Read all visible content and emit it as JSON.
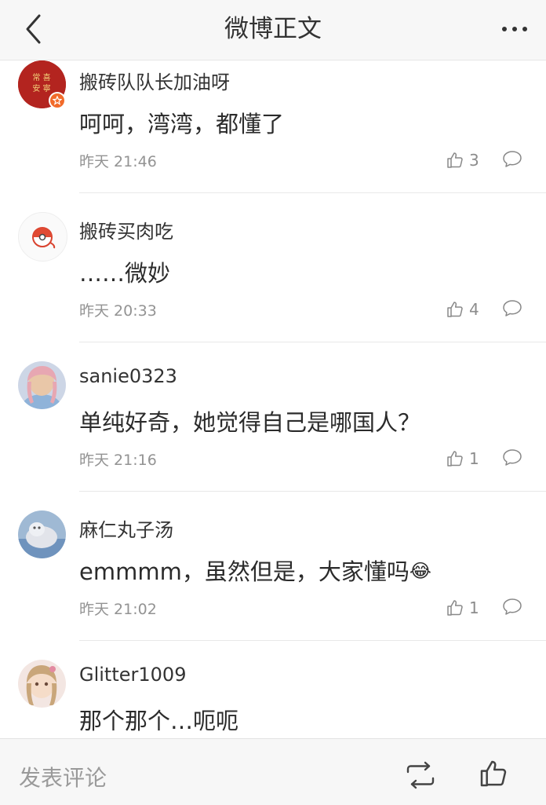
{
  "header": {
    "title": "微博正文",
    "back_icon": "chevron-left-icon",
    "more_icon": "ellipsis-icon"
  },
  "comments": [
    {
      "username": "搬砖队队长加油呀",
      "content": "呵呵，湾湾，都懂了",
      "time": "昨天 21:46",
      "likes": "3",
      "avatar_text": "常安寧"
    },
    {
      "username": "搬砖买肉吃",
      "content": "……微妙",
      "time": "昨天 20:33",
      "likes": "4"
    },
    {
      "username": "sanie0323",
      "content": "单纯好奇，她觉得自己是哪国人？",
      "time": "昨天 21:16",
      "likes": "1"
    },
    {
      "username": "麻仁丸子汤",
      "content": "emmmm，虽然但是，大家懂吗",
      "time": "昨天 21:02",
      "likes": "1",
      "emoji": "😂"
    },
    {
      "username": "Glitter1009",
      "content": "那个那个…呃呃"
    }
  ],
  "bottom_bar": {
    "comment_placeholder": "发表评论",
    "repost_icon": "repost-icon",
    "like_icon": "thumbs-up-icon"
  },
  "colors": {
    "header_bg": "#f7f7f7",
    "secondary_text": "#939393",
    "badge_orange": "#f26b2a"
  }
}
